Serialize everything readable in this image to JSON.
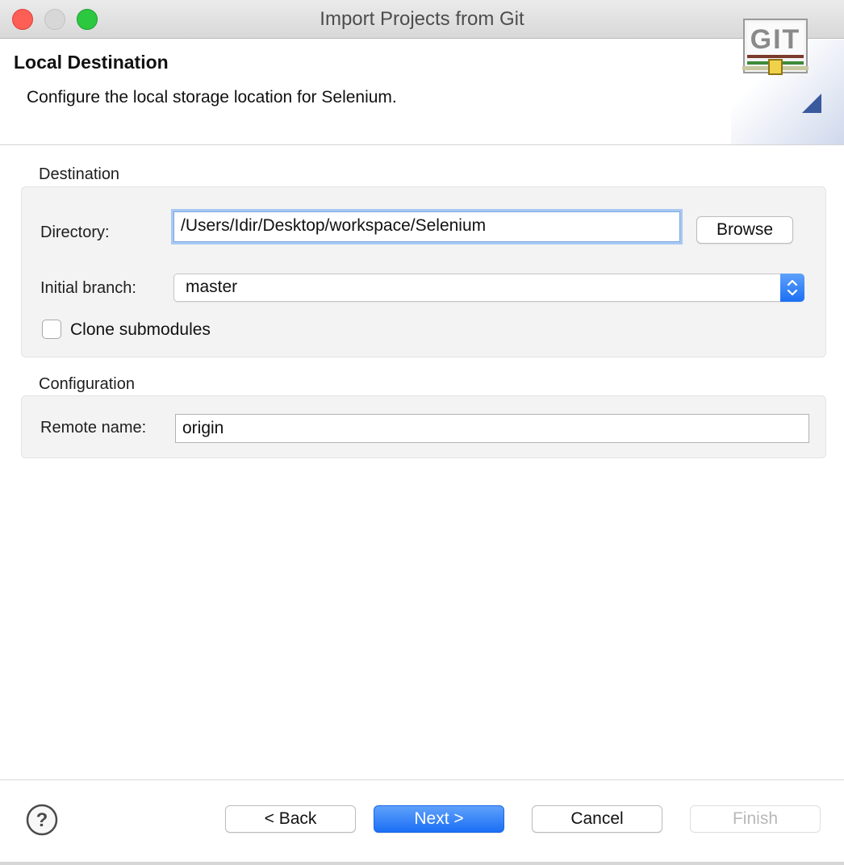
{
  "window": {
    "title": "Import Projects from Git"
  },
  "banner": {
    "title": "Local Destination",
    "description": "Configure the local storage location for Selenium.",
    "logo_text": "GIT"
  },
  "destination": {
    "group_label": "Destination",
    "directory_label": "Directory:",
    "directory_value": "/Users/Idir/Desktop/workspace/Selenium",
    "browse_label": "Browse",
    "branch_label": "Initial branch:",
    "branch_value": "master",
    "clone_submodules_label": "Clone submodules",
    "clone_submodules_checked": false
  },
  "configuration": {
    "group_label": "Configuration",
    "remote_name_label": "Remote name:",
    "remote_name_value": "origin"
  },
  "footer": {
    "back_label": "< Back",
    "next_label": "Next >",
    "cancel_label": "Cancel",
    "finish_label": "Finish"
  },
  "icons": {
    "help": "question-mark-circle-icon",
    "logo": "git-logo-icon",
    "stepper": "up-down-chevron-icon"
  },
  "colors": {
    "accent": "#1b6ff5",
    "focus_ring": "#a8c8f3",
    "close": "#fd5f57",
    "maximize": "#2cc840"
  }
}
